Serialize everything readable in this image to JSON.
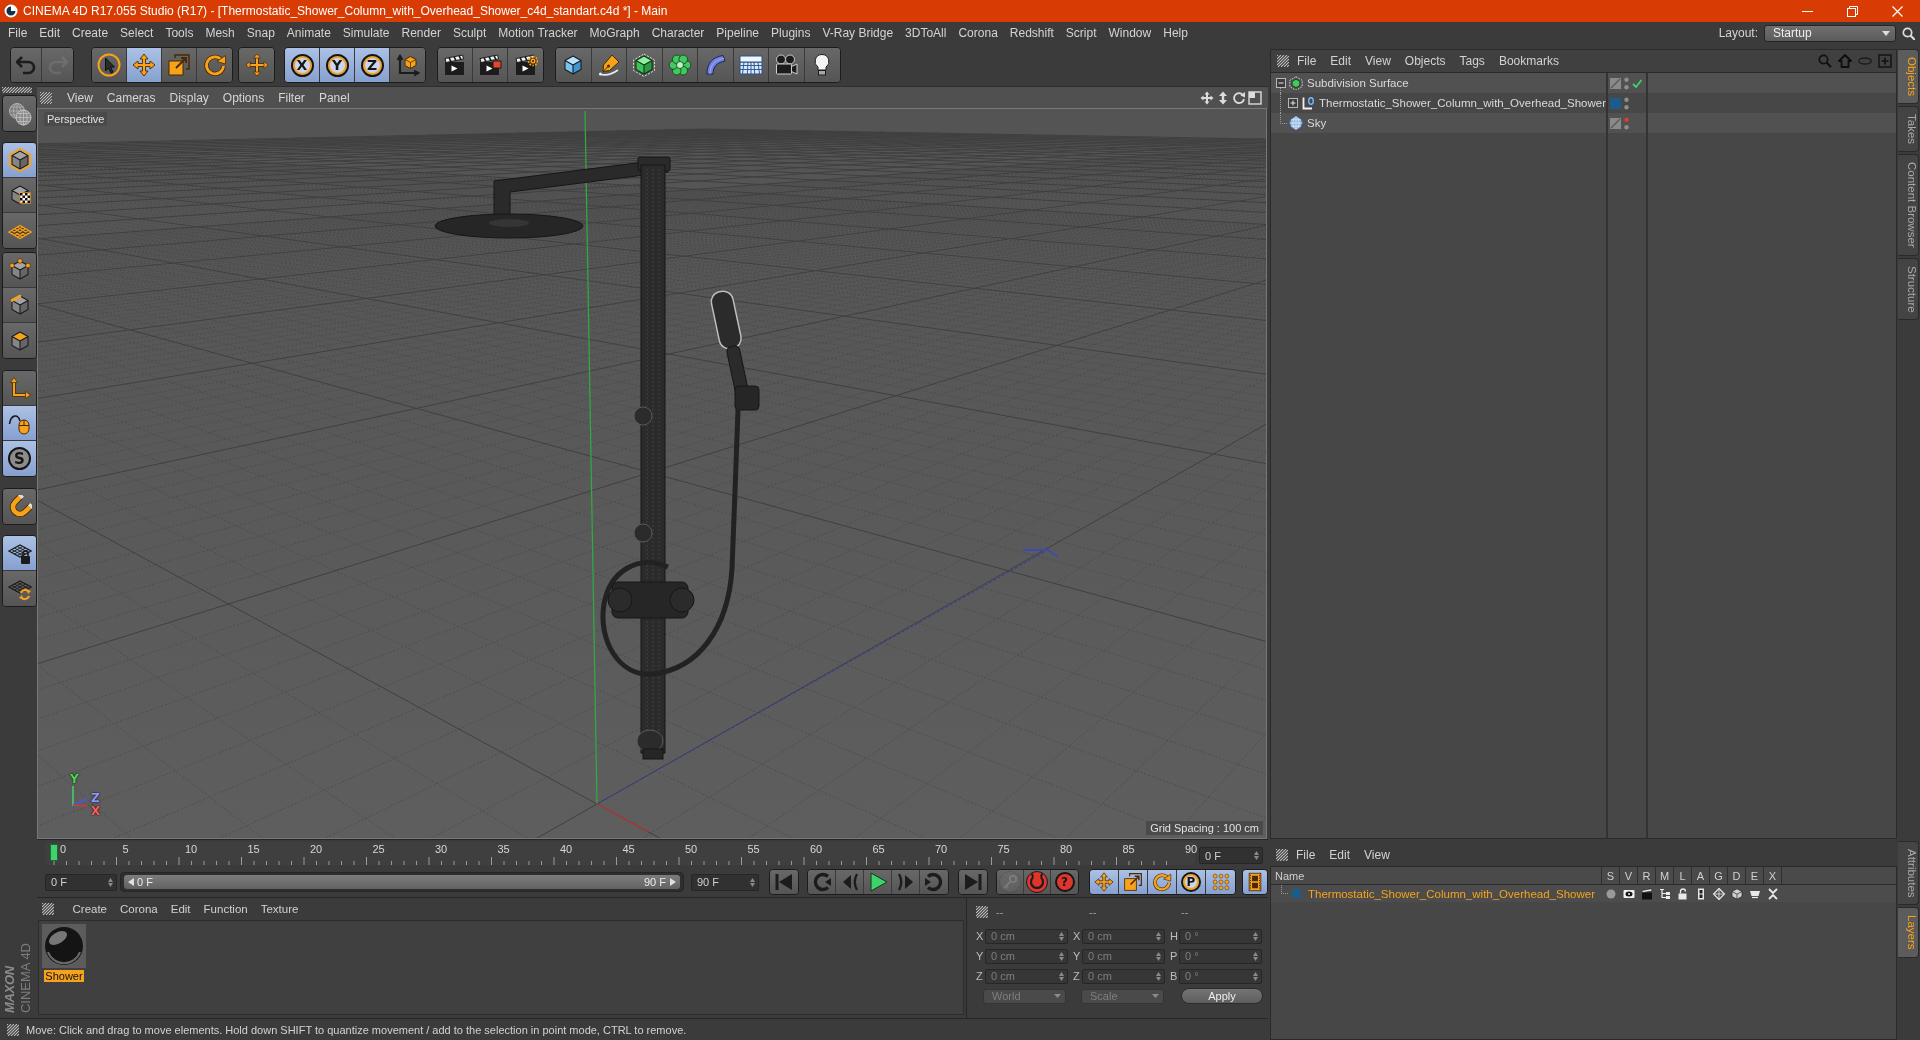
{
  "window": {
    "title": "CINEMA 4D R17.055 Studio (R17) - [Thermostatic_Shower_Column_with_Overhead_Shower_c4d_standart.c4d *] - Main"
  },
  "menu_bar": [
    "File",
    "Edit",
    "Create",
    "Select",
    "Tools",
    "Mesh",
    "Snap",
    "Animate",
    "Simulate",
    "Render",
    "Sculpt",
    "Motion Tracker",
    "MoGraph",
    "Character",
    "Pipeline",
    "Plugins",
    "V-Ray Bridge",
    "3DToAll",
    "Corona",
    "Redshift",
    "Script",
    "Window",
    "Help"
  ],
  "layout": {
    "label": "Layout:",
    "value": "Startup"
  },
  "toolbar": {
    "history": [
      {
        "disabled": false
      },
      {
        "disabled": true
      }
    ],
    "tools": [
      {
        "selected": false
      },
      {
        "selected": true
      },
      {
        "selected": false
      },
      {
        "selected": false
      }
    ],
    "recent_tool": {
      "selected": false
    },
    "axis_locks": [
      {
        "label": "X",
        "selected": true
      },
      {
        "label": "Y",
        "selected": true
      },
      {
        "label": "Z",
        "selected": true
      }
    ],
    "world_coordinates": {
      "selected": false
    }
  },
  "mode_palette": [
    [
      {
        "selected": false
      }
    ],
    [
      {
        "selected": true
      },
      {
        "selected": false
      },
      {
        "selected": false
      }
    ],
    [
      {
        "selected": false
      },
      {
        "selected": false
      },
      {
        "selected": false
      }
    ],
    [
      {
        "selected": false
      },
      {
        "selected": true
      },
      {
        "selected": true,
        "label": "S"
      }
    ],
    [
      {
        "selected": false
      }
    ],
    [
      {
        "selected": true
      },
      {
        "selected": false
      }
    ]
  ],
  "logo": {
    "brand": "MAXON",
    "product": "CINEMA 4D"
  },
  "viewport": {
    "menu": [
      "View",
      "Cameras",
      "Display",
      "Options",
      "Filter",
      "Panel"
    ],
    "camera": "Perspective",
    "grid_spacing": "Grid Spacing : 100 cm",
    "axis_labels": [
      {
        "label": "Y",
        "color": "#4cd84c"
      },
      {
        "label": "Z",
        "color": "#8a94ff"
      },
      {
        "label": "X",
        "color": "#ff5a5a"
      }
    ]
  },
  "timeline": {
    "ticks": [
      "0",
      "5",
      "10",
      "15",
      "20",
      "25",
      "30",
      "35",
      "40",
      "45",
      "50",
      "55",
      "60",
      "65",
      "70",
      "75",
      "80",
      "85",
      "90"
    ],
    "playhead": {
      "level": 0
    },
    "current_frame": "0 F",
    "start_frame": "0 F",
    "preview_range": {
      "start": "0 F",
      "end": "90 F",
      "level": 1
    },
    "end_frame": "90 F",
    "record_buttons": [
      {
        "disabled": true
      },
      {
        "disabled": false
      },
      {
        "disabled": false,
        "label": "?"
      }
    ],
    "animation_toggles": [
      {
        "selected": true
      },
      {
        "selected": true
      },
      {
        "selected": true
      },
      {
        "selected": true,
        "label": "P"
      },
      {
        "selected": true
      }
    ],
    "timeline_button": {
      "selected": true
    }
  },
  "material_manager": {
    "menu": [
      "Create",
      "Corona",
      "Edit",
      "Function",
      "Texture"
    ],
    "materials": [
      {
        "name": "Shower",
        "selected": true
      }
    ]
  },
  "coordinates": {
    "columns": [
      "--",
      "--",
      "--"
    ],
    "rows": [
      {
        "axis": "X",
        "position": "0 cm",
        "size_axis": "X",
        "size": "0 cm",
        "rotation_axis": "H",
        "rotation": "0 °"
      },
      {
        "axis": "Y",
        "position": "0 cm",
        "size_axis": "Y",
        "size": "0 cm",
        "rotation_axis": "P",
        "rotation": "0 °"
      },
      {
        "axis": "Z",
        "position": "0 cm",
        "size_axis": "Z",
        "size": "0 cm",
        "rotation_axis": "B",
        "rotation": "0 °"
      }
    ],
    "disabled": true,
    "dropdowns": [
      "World",
      "Scale"
    ],
    "apply": "Apply"
  },
  "status_bar": "Move: Click and drag to move elements. Hold down SHIFT to quantize movement / add to the selection in point mode, CTRL to remove.",
  "object_manager": {
    "menu": [
      "File",
      "Edit",
      "View",
      "Objects",
      "Tags",
      "Bookmarks"
    ],
    "objects": [
      {
        "name": "Subdivision Surface",
        "kind": "subdivision",
        "expanded": true,
        "editor_visible": true,
        "enabled": true,
        "children": [
          {
            "name": "Thermostatic_Shower_Column_with_Overhead_Shower",
            "kind": "null",
            "expanded": false,
            "editor_visible": true,
            "color": "#1b5d8a"
          }
        ]
      },
      {
        "name": "Sky",
        "kind": "sky",
        "editor_visible": false
      }
    ]
  },
  "layer_manager": {
    "menu": [
      "File",
      "Edit",
      "View"
    ],
    "columns": [
      "Name",
      "S",
      "V",
      "R",
      "M",
      "L",
      "A",
      "G",
      "D",
      "E",
      "X"
    ],
    "layers": [
      {
        "name": "Thermostatic_Shower_Column_with_Overhead_Shower",
        "color": "#1b5d8a",
        "selected": true
      }
    ]
  },
  "side_tabs": {
    "top": [
      {
        "label": "Objects",
        "selected": true
      },
      {
        "label": "Takes",
        "selected": false
      },
      {
        "label": "Content Browser",
        "selected": false
      },
      {
        "label": "Structure",
        "selected": false
      }
    ],
    "bottom": [
      {
        "label": "Attributes",
        "selected": false
      },
      {
        "label": "Layers",
        "selected": true
      }
    ]
  }
}
